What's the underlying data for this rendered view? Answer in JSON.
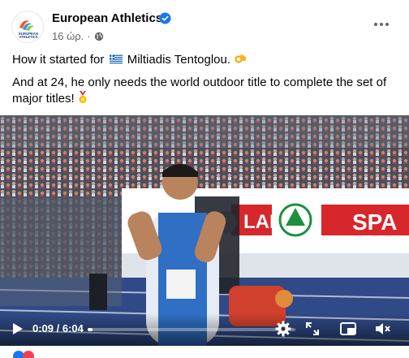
{
  "post": {
    "page_name": "European Athletics",
    "time_ago": "16 ώρ.",
    "separator": "·",
    "line1_prefix": "How it started for",
    "line1_suffix": "Miltiadis Tentoglou.",
    "line2": "And at 24, he only needs the world outdoor title to complete the set of major titles!",
    "avatar_logo_text": "EUROPEAN ATHLETICS"
  },
  "video": {
    "current_time": "0:09",
    "duration": "6:04",
    "time_separator": " / ",
    "progress_fraction": 0.025,
    "banner_text_1": "LAR",
    "banner_text_2": "SPA"
  },
  "colors": {
    "verified": "#1877f2",
    "accent": "#0866ff",
    "banner_red": "#d7262c",
    "track_blue": "#2f4a86"
  },
  "icons": [
    "verified-badge-icon",
    "globe-icon",
    "more-options-icon",
    "play-icon",
    "settings-icon",
    "fullscreen-icon",
    "miniplayer-icon",
    "volume-muted-icon"
  ]
}
